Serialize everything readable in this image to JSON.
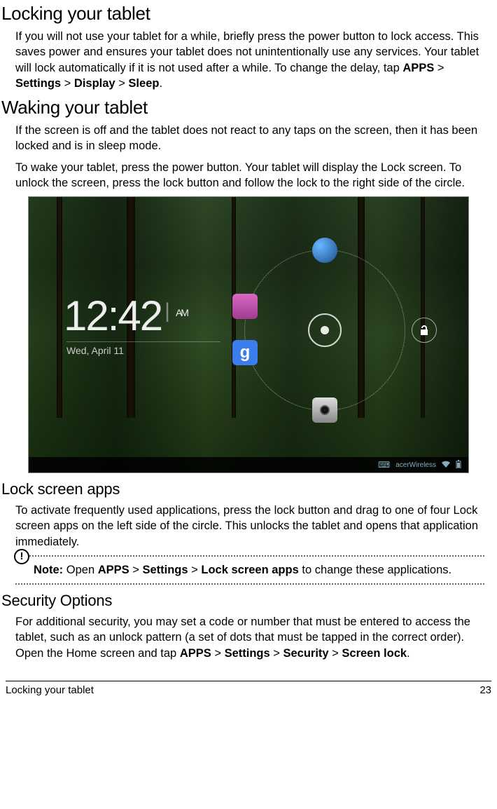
{
  "sections": {
    "locking": {
      "heading": "Locking your tablet",
      "body_p1_pre": "If you will not use your tablet for a while, briefly press the power button to lock access. This saves power and ensures your tablet does not unintentionally use any services. Your tablet will lock automatically if it is not used after a while. To change the delay, tap ",
      "path1": "APPS",
      "sep": " > ",
      "path2": "Settings",
      "path3": "Display",
      "path4": "Sleep",
      "period": "."
    },
    "waking": {
      "heading": "Waking your tablet",
      "body_p1": "If the screen is off and the tablet does not react to any taps on the screen, then it has been locked and is in sleep mode.",
      "body_p2": "To wake your tablet, press the power button. Your tablet will display the Lock screen. To unlock the screen, press the lock button and follow the lock to the right side of the circle."
    },
    "lockapps": {
      "heading": "Lock screen apps",
      "body_p1": "To activate frequently used applications, press the lock button and drag to one of four Lock screen apps on the left side of the circle. This unlocks the tablet and opens that application immediately.",
      "note_label": "Note:",
      "note_pre": " Open ",
      "note_path1": "APPS",
      "note_path2": "Settings",
      "note_path3": "Lock screen apps",
      "note_post": " to change these applications."
    },
    "security": {
      "heading": "Security Options",
      "body_pre": "For additional security, you may set a code or number that must be entered to access the tablet, such as an unlock pattern (a set of dots that must be tapped in the correct order). Open the Home screen and tap ",
      "path1": "APPS",
      "path2": "Settings",
      "path3": "Security",
      "path4": "Screen lock",
      "period": "."
    }
  },
  "screenshot": {
    "time": "12:42",
    "ampm": "AM",
    "date": "Wed, April 11",
    "statusbar_network": "acerWireless",
    "app_icons": {
      "top": "browser-globe-icon",
      "left_upper": "gallery-icon",
      "left_lower": "google-search-icon",
      "bottom": "camera-icon"
    },
    "unlock_icon": "unlock-padlock-icon"
  },
  "footer": {
    "chapter": "Locking your tablet",
    "page": "23"
  },
  "icons": {
    "note": "!"
  }
}
